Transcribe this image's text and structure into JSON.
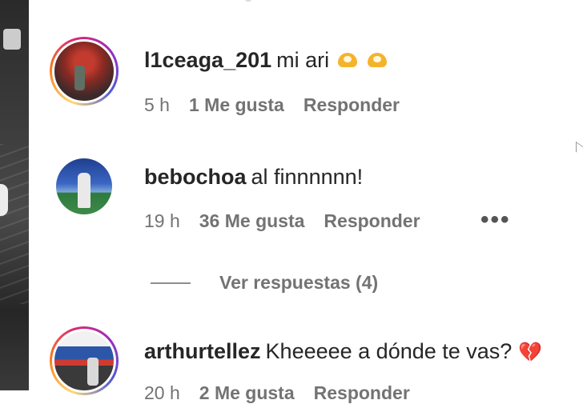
{
  "comments": [
    {
      "username": "l1ceaga_201",
      "text": "mi ari",
      "time": "5 h",
      "likes": "1 Me gusta",
      "reply": "Responder"
    },
    {
      "username": "bebochoa",
      "text": "al finnnnnn!",
      "time": "19 h",
      "likes": "36 Me gusta",
      "reply": "Responder"
    },
    {
      "username": "arthurtellez",
      "text": "Kheeeee a dónde te vas?",
      "time": "20 h",
      "likes": "2 Me gusta",
      "reply": "Responder"
    }
  ],
  "view_replies": "Ver respuestas (4)",
  "icons": {
    "comment1_emoji": "heart-hands-icon",
    "comment3_emoji": "broken-heart-icon",
    "more": "more-options-icon"
  }
}
